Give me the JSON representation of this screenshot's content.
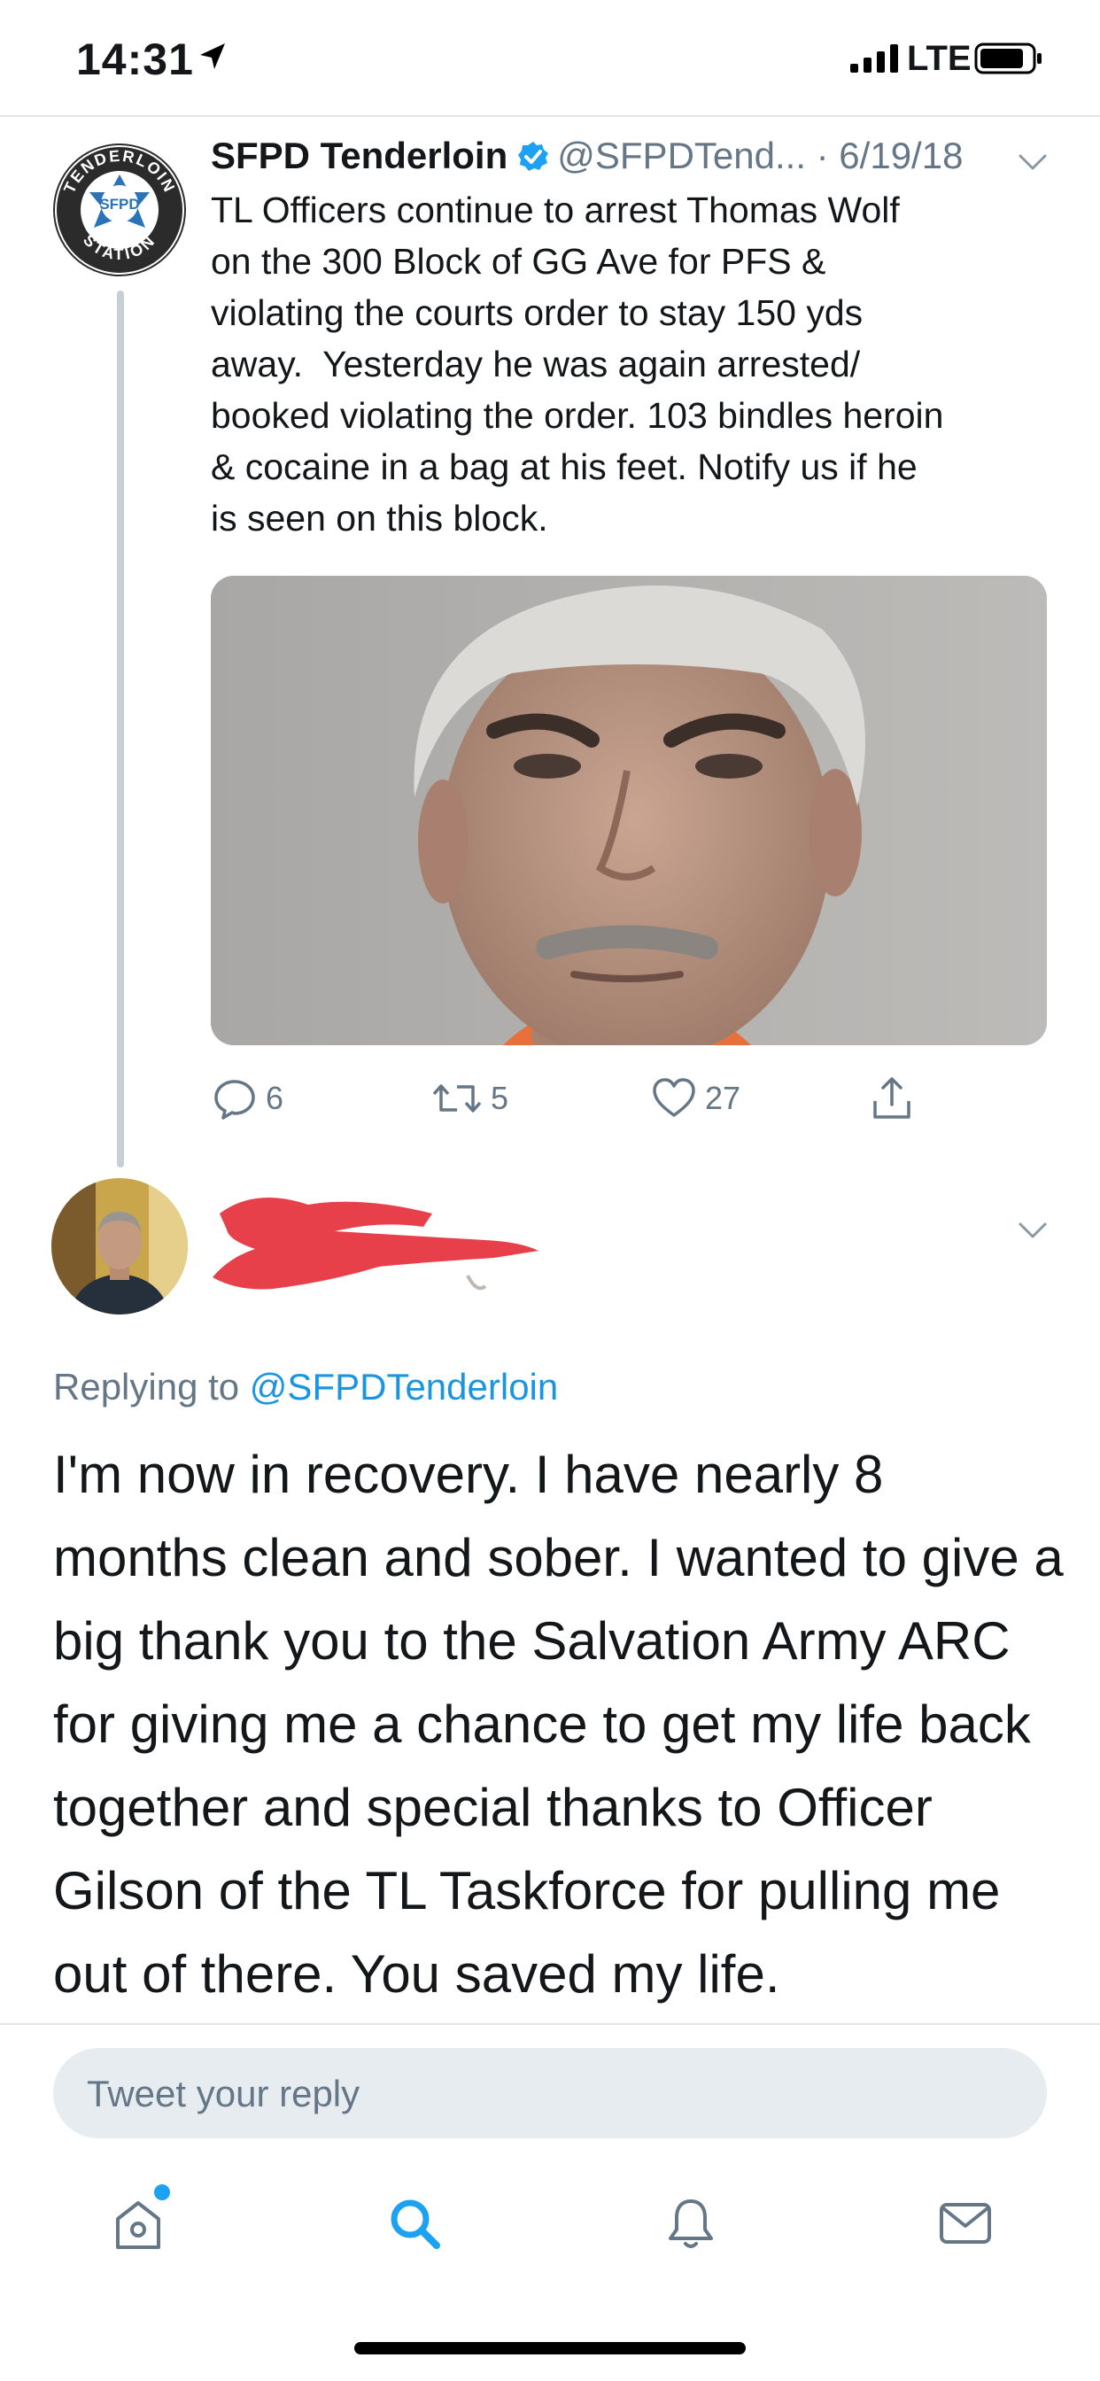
{
  "status_bar": {
    "time": "14:31",
    "network": "LTE"
  },
  "tweet": {
    "author_name": "SFPD Tenderloin",
    "handle_date": "@SFPDTend... · 6/19/18",
    "text": "TL Officers continue to arrest Thomas Wolf\non the 300 Block of GG Ave for PFS &\nviolating the courts order to stay 150 yds\naway.  Yesterday he was again arrested/\nbooked violating the order. 103 bindles heroin\n& cocaine in a bag at his feet. Notify us if he\nis seen on this block.",
    "avatar": {
      "top_text": "TENDERLOIN",
      "center_text": "SFPD",
      "bottom_text": "STATION"
    },
    "reply_count": "6",
    "retweet_count": "5",
    "like_count": "27"
  },
  "reply": {
    "replying_prefix": "Replying to ",
    "replying_handle": "@SFPDTenderloin",
    "text": "I'm now in recovery. I have nearly 8 months clean and sober. I wanted to give a big thank you to the Salvation Army ARC for giving me a chance to get my life back together and special thanks to Officer Gilson of the TL Taskforce for pulling me out of there. You saved my life."
  },
  "composer": {
    "placeholder": "Tweet your reply"
  },
  "tabbar": {
    "items": [
      "home-icon",
      "search-icon",
      "notifications-icon",
      "messages-icon"
    ]
  },
  "colors": {
    "accent": "#1da1f2",
    "link": "#1b95e0",
    "secondary_text": "#657786",
    "redaction": "#e8404a"
  }
}
